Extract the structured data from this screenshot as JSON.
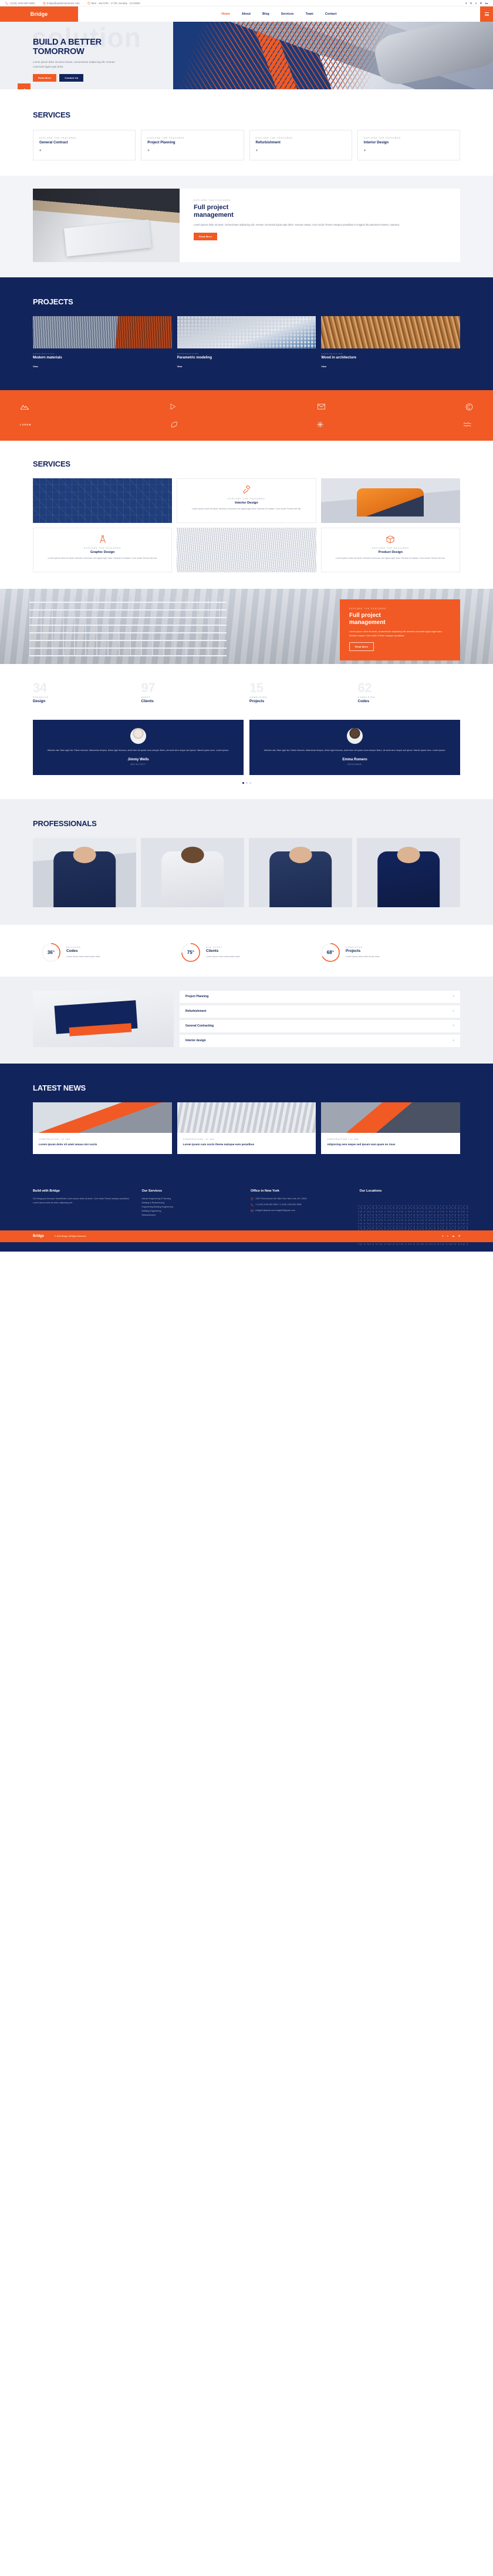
{
  "brand": {
    "name": "Bridge",
    "accent": "#f15a24",
    "navy": "#12245c"
  },
  "topbar": {
    "phone": "+(123) 1234-567-8901",
    "email": "bridge@qodeinteractive.com",
    "hours": "Mon - Sat 8:00 - 17:30, Sunday - CLOSED",
    "socials": [
      "f",
      "V",
      "t",
      "P",
      "in"
    ]
  },
  "nav": {
    "items": [
      {
        "label": "Home",
        "active": true
      },
      {
        "label": "About",
        "active": false
      },
      {
        "label": "Blog",
        "active": false
      },
      {
        "label": "Services",
        "active": false
      },
      {
        "label": "Team",
        "active": false
      },
      {
        "label": "Contact",
        "active": false
      }
    ]
  },
  "hero": {
    "ghost": "solution",
    "title_line1": "BUILD A BETTER",
    "title_line2": "TOMORROW",
    "paragraph": "Lorem ipsum dolor sit amet messa, consectetuer adipiscing elit. Aenean commodo ligula eget dolor.",
    "btn_primary": "Read More",
    "btn_secondary": "Contact Us",
    "tab_icon": "chevron-left-icon"
  },
  "services1": {
    "title": "SERVICES",
    "cards": [
      {
        "eyebrow": "EXPLORE THE FEATURES",
        "title": "General Contract",
        "plus": "+"
      },
      {
        "eyebrow": "EXPLORE THE FEATURES",
        "title": "Project Planning",
        "plus": "+"
      },
      {
        "eyebrow": "EXPLORE THE FEATURES",
        "title": "Refurbishment",
        "plus": "+"
      },
      {
        "eyebrow": "EXPLORE THE FEATURES",
        "title": "Interior Design",
        "plus": "+"
      }
    ]
  },
  "feature1": {
    "eyebrow": "EXPLORE THE FEATURES",
    "title_line1": "Full project",
    "title_line2": "management",
    "paragraph": "Lorem ipsum dolor sit amet, consectetuer adipiscing elit. Aenean commodo ligula eget dolor. Aenean massa. Cum sociis Theme natoque penatibus et magnis dis parturient montes, nascetur.",
    "button": "Read More"
  },
  "projects": {
    "title": "PROJECTS",
    "items": [
      {
        "category": "CONSTRUCTION",
        "title": "Modern materials",
        "link": "View"
      },
      {
        "category": "CONSTRUCTION",
        "title": "Parametric modeling",
        "link": "View"
      },
      {
        "category": "CONSTRUCTION",
        "title": "Wood in architecture",
        "link": "View"
      }
    ]
  },
  "clients": {
    "row1": [
      "mountain-logo",
      "play-logo",
      "envelope-logo",
      "c-circle-logo"
    ],
    "row2": [
      "lorem-ipsum-logo",
      "leaf-logo",
      "burst-logo",
      "waves-logo"
    ]
  },
  "services2": {
    "title": "SERVICES",
    "cards": [
      {
        "icon": "paint-brush-icon",
        "eyebrow": "EXPLORE THE FEATURES",
        "title": "Interior Design",
        "text": "Lorem ipsum dolor sit amet. Aenean commodo nec ligula eget dolor. Aenean et massa. Cum sociis Theme elit nisi."
      },
      {
        "icon": "compass-icon",
        "eyebrow": "EXPLORE THE FEATURES",
        "title": "Graphic Design",
        "text": "Lorem ipsum dolor sit amet. Aenean commodo nec ligula eget dolor. Aenean et massa. Cum sociis Theme elit nisi."
      },
      {
        "icon": "package-icon",
        "eyebrow": "EXPLORE THE FEATURES",
        "title": "Product Design",
        "text": "Lorem ipsum dolor sit amet. Aenean commodo nec ligula eget dolor. Aenean et massa. Cum sociis Theme elit nisi."
      }
    ]
  },
  "feature2": {
    "eyebrow": "EXPLORE THE FEATURES",
    "title_line1": "Full project",
    "title_line2": "management",
    "paragraph": "Lorem ipsum dolor sit amet, consectetuer adipiscing elit. Aenean commodo ligula eget dolor. Aenean massa. Cum sociis Theme natoque penatibus.",
    "button": "Read More"
  },
  "counters": [
    {
      "number": "34",
      "eyebrow": "PROJECTS",
      "label": "Design"
    },
    {
      "number": "97",
      "eyebrow": "HAPPY",
      "label": "Clients"
    },
    {
      "number": "15",
      "eyebrow": "COMPLETED",
      "label": "Projects"
    },
    {
      "number": "62",
      "eyebrow": "COMPLETED",
      "label": "Codes"
    }
  ],
  "testimonials": {
    "items": [
      {
        "quote": "Ultricies nisi. Nam eget dui. Etiam rhoncus. Maecenas tempus, tellus eget rhoncus, amet sem vel quam nunc semper libero, sit amet sem neque sed ipsum. Namet quam nunc. Lorem ipsum.",
        "name": "Jimmy Wells",
        "role": "ARCHITECT"
      },
      {
        "quote": "Ultricies nisi. Nam eget dui. Etiam rhoncus. Maecenas tempus, tellus eget rhoncus, amet sem vel quam nunc semper libero, sit amet sem neque sed ipsum. Namet quam nunc. Lorem ipsum.",
        "name": "Emma Romero",
        "role": "DESIGNER"
      }
    ],
    "dots": 3,
    "active_dot": 0
  },
  "professionals": {
    "title": "PROFESSIONALS",
    "members": [
      "member-1",
      "member-2",
      "member-3",
      "member-4"
    ]
  },
  "pies": [
    {
      "value": "36",
      "unit": "%",
      "percent": 36,
      "eyebrow": "DESIGNED",
      "title": "Codes",
      "text": "Lorem ipsum dolor amet sociis dolor."
    },
    {
      "value": "75",
      "unit": "%",
      "percent": 75,
      "eyebrow": "OUR HAPPY",
      "title": "Clients",
      "text": "Lorem ipsum dolor amet sociis dolor."
    },
    {
      "value": "68",
      "unit": "%",
      "percent": 68,
      "eyebrow": "COMPLETED",
      "title": "Projects",
      "text": "Lorem ipsum dolor amet sociis dolor."
    }
  ],
  "accordion": {
    "rows": [
      {
        "label": "Project Planning",
        "chev": "+",
        "open": true
      },
      {
        "label": "Refurbishment",
        "chev": "+",
        "open": false
      },
      {
        "label": "General Contracting",
        "chev": "+",
        "open": false
      },
      {
        "label": "Interior design",
        "chev": "+",
        "open": false
      }
    ]
  },
  "news": {
    "title": "LATEST NEWS",
    "items": [
      {
        "meta": "CONSTRUCTION / 12 JAN",
        "title": "Lorem ipsum dolor sit amet amasa nisi sociis"
      },
      {
        "meta": "CONSTRUCTION / 12 JAN",
        "title": "Lorem ipsum cum sociis theme natoque eum penatibus"
      },
      {
        "meta": "CONSTRUCTION / 12 JAN",
        "title": "Adipiscing sem neque sed ipsum nam quam no risus"
      }
    ]
  },
  "footer": {
    "columns": [
      {
        "title": "Build with Bridge",
        "type": "text",
        "text": "Get things just because Varsethinks Lorem ipsum dolor sit amet. Cum sociis Theme natoque penatibus. Lorem ipsum dolor sit amet, adipiscing elit."
      },
      {
        "title": "Our Services",
        "type": "list",
        "items": [
          "Interior Engineering & Planning",
          "Building & Restructuring",
          "Engineering Building Engineering",
          "Building Engineering",
          "Refurbishment"
        ]
      },
      {
        "title": "Office in New York",
        "type": "contact",
        "items": [
          {
            "icon": "pin-icon",
            "text": "1000 Third Avenue Ste 36th Floor New York, NY 10022"
          },
          {
            "icon": "phone-icon",
            "text": "+1 (123) 1234-567-8901\n+1 (123) 1234-567-8902"
          },
          {
            "icon": "mail-icon",
            "text": "bridge01@qode.com\nbridge02@qode.com"
          }
        ]
      },
      {
        "title": "Our Locations",
        "type": "map",
        "text": ""
      }
    ],
    "bar": {
      "logo": "Bridge",
      "copyright": "© 2020 Bridge. All Rights Reserved.",
      "socials": [
        "f",
        "t",
        "in",
        "P"
      ]
    }
  }
}
